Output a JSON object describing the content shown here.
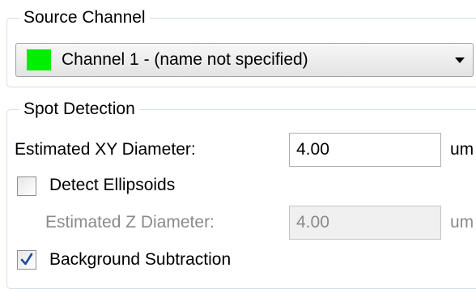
{
  "source_channel": {
    "title": "Source Channel",
    "selected": "Channel 1 - (name not specified)",
    "swatch_color": "#00ee00"
  },
  "spot_detection": {
    "title": "Spot Detection",
    "xy_label": "Estimated XY Diameter:",
    "xy_value": "4.00",
    "xy_unit": "um",
    "ellipsoids_label": "Detect Ellipsoids",
    "ellipsoids_checked": false,
    "z_label": "Estimated Z Diameter:",
    "z_value": "4.00",
    "z_unit": "um",
    "background_label": "Background Subtraction",
    "background_checked": true
  },
  "colors": {
    "group_border": "#d5dfe5",
    "disabled_text": "#8a8a8a",
    "checkmark": "#1d4d9b"
  },
  "icons": {
    "dropdown": "chevron-down-icon",
    "check": "checkmark-icon"
  }
}
